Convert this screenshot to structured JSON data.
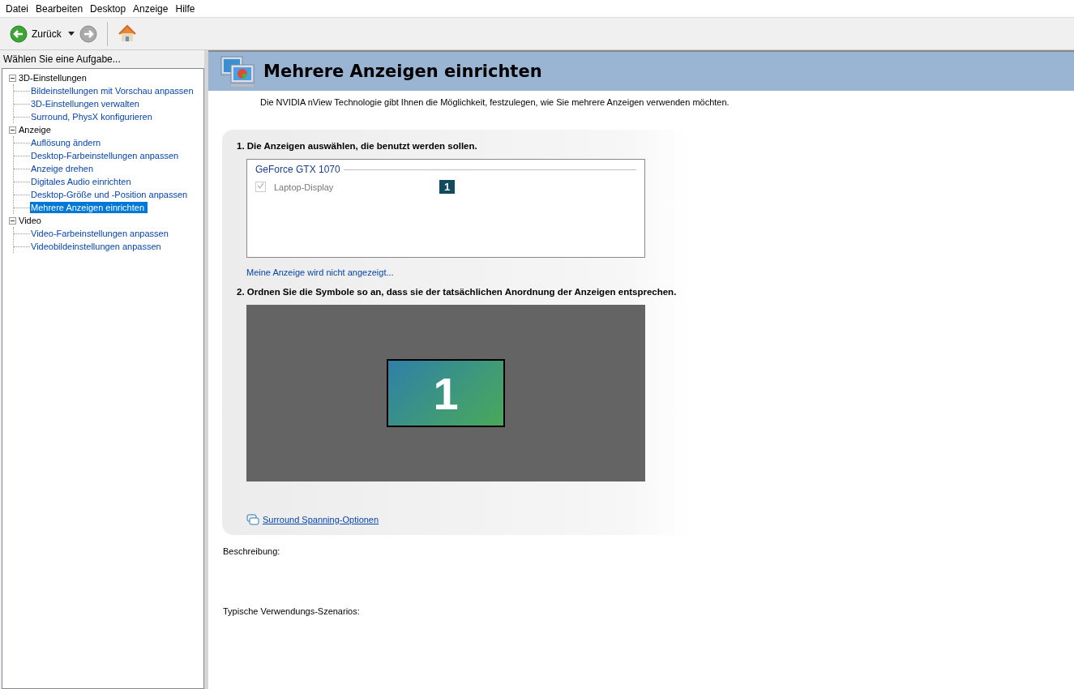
{
  "menu": [
    "Datei",
    "Bearbeiten",
    "Desktop",
    "Anzeige",
    "Hilfe"
  ],
  "toolbar": {
    "back_label": "Zurück"
  },
  "sidebar": {
    "title": "Wählen Sie eine Aufgabe...",
    "tree": [
      {
        "label": "3D-Einstellungen",
        "expanded": true,
        "children": [
          {
            "label": "Bildeinstellungen mit Vorschau anpassen",
            "selected": false
          },
          {
            "label": "3D-Einstellungen verwalten",
            "selected": false
          },
          {
            "label": "Surround, PhysX konfigurieren",
            "selected": false
          }
        ]
      },
      {
        "label": "Anzeige",
        "expanded": true,
        "children": [
          {
            "label": "Auflösung ändern",
            "selected": false
          },
          {
            "label": "Desktop-Farbeinstellungen anpassen",
            "selected": false
          },
          {
            "label": "Anzeige drehen",
            "selected": false
          },
          {
            "label": "Digitales Audio einrichten",
            "selected": false
          },
          {
            "label": "Desktop-Größe und -Position anpassen",
            "selected": false
          },
          {
            "label": "Mehrere Anzeigen einrichten",
            "selected": true
          }
        ]
      },
      {
        "label": "Video",
        "expanded": true,
        "children": [
          {
            "label": "Video-Farbeinstellungen anpassen",
            "selected": false
          },
          {
            "label": "Videobildeinstellungen anpassen",
            "selected": false
          }
        ]
      }
    ]
  },
  "page": {
    "title": "Mehrere Anzeigen einrichten",
    "intro": "Die NVIDIA nView Technologie gibt Ihnen die Möglichkeit, festzulegen, wie Sie mehrere Anzeigen verwenden möchten.",
    "step1": {
      "heading": "1. Die Anzeigen auswählen, die benutzt werden sollen.",
      "gpu": "GeForce GTX 1070",
      "displays": [
        {
          "name": "Laptop-Display",
          "checked": true,
          "disabled": true,
          "number": "1"
        }
      ],
      "link": "Meine Anzeige wird nicht angezeigt..."
    },
    "step2": {
      "heading": "2. Ordnen Sie die Symbole so an, dass sie der tatsächlichen Anordnung der Anzeigen entsprechen.",
      "monitors": [
        {
          "number": "1"
        }
      ],
      "link": "Surround Spanning-Optionen"
    },
    "description_label": "Beschreibung:",
    "scenarios_label": "Typische Verwendungs-Szenarios:"
  }
}
